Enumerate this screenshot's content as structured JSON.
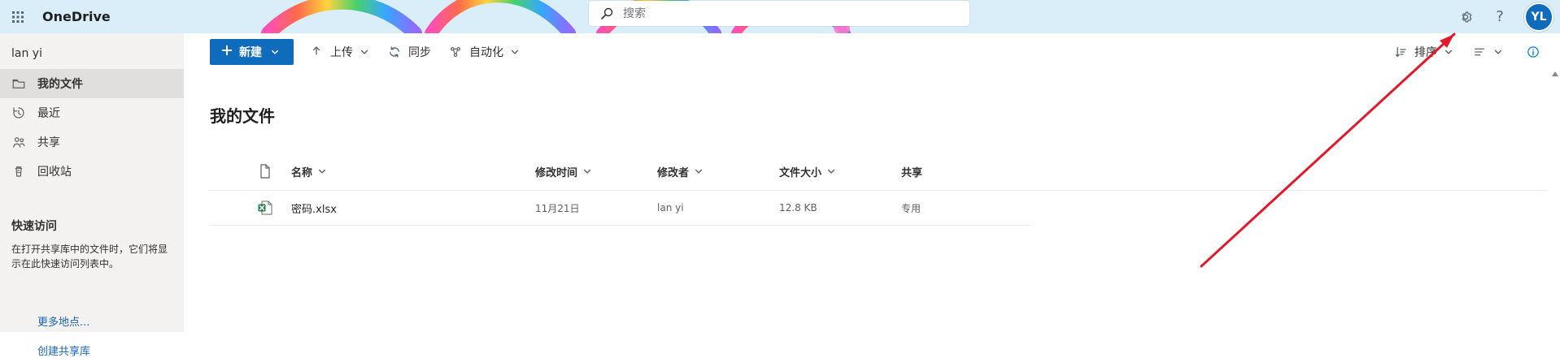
{
  "app": {
    "name": "OneDrive",
    "search_placeholder": "搜索",
    "avatar_initials": "YL"
  },
  "sidebar": {
    "user_name": "lan yi",
    "nav": [
      {
        "label": "我的文件",
        "icon": "folder-icon",
        "active": true
      },
      {
        "label": "最近",
        "icon": "history-icon",
        "active": false
      },
      {
        "label": "共享",
        "icon": "people-icon",
        "active": false
      },
      {
        "label": "回收站",
        "icon": "recycle-bin-icon",
        "active": false
      }
    ],
    "quick_access": {
      "title": "快速访问",
      "description": "在打开共享库中的文件时，它们将显示在此快速访问列表中。",
      "links": [
        "更多地点...",
        "创建共享库"
      ]
    }
  },
  "commandbar": {
    "new_label": "新建",
    "upload_label": "上传",
    "sync_label": "同步",
    "automate_label": "自动化",
    "sort_label": "排序"
  },
  "main": {
    "title": "我的文件",
    "columns": {
      "name": "名称",
      "modified": "修改时间",
      "modified_by": "修改者",
      "size": "文件大小",
      "sharing": "共享"
    },
    "rows": [
      {
        "name": "密码.xlsx",
        "modified": "11月21日",
        "modified_by": "lan yi",
        "size": "12.8 KB",
        "sharing": "专用",
        "file_icon": "excel-file-icon"
      }
    ]
  },
  "colors": {
    "topbar": "#d9eef9",
    "primary_button": "#0f6cbd",
    "annotation_red": "#e2192b"
  }
}
